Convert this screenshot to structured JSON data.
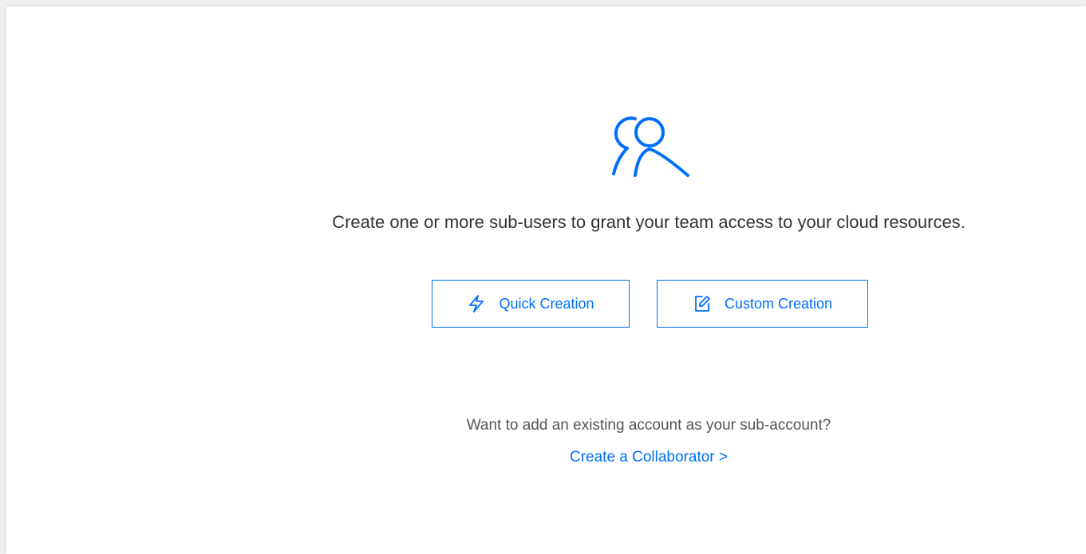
{
  "empty_state": {
    "icon": "users-icon",
    "message": "Create one or more sub-users to grant your team access to your cloud resources."
  },
  "actions": {
    "quick_creation": {
      "label": "Quick Creation",
      "icon": "lightning-icon"
    },
    "custom_creation": {
      "label": "Custom Creation",
      "icon": "edit-icon"
    }
  },
  "collaborator": {
    "question": "Want to add an existing account as your sub-account?",
    "link_label": "Create a Collaborator >"
  },
  "colors": {
    "accent": "#006eff",
    "text": "#333333",
    "muted_text": "#555555",
    "background": "#ffffff"
  }
}
